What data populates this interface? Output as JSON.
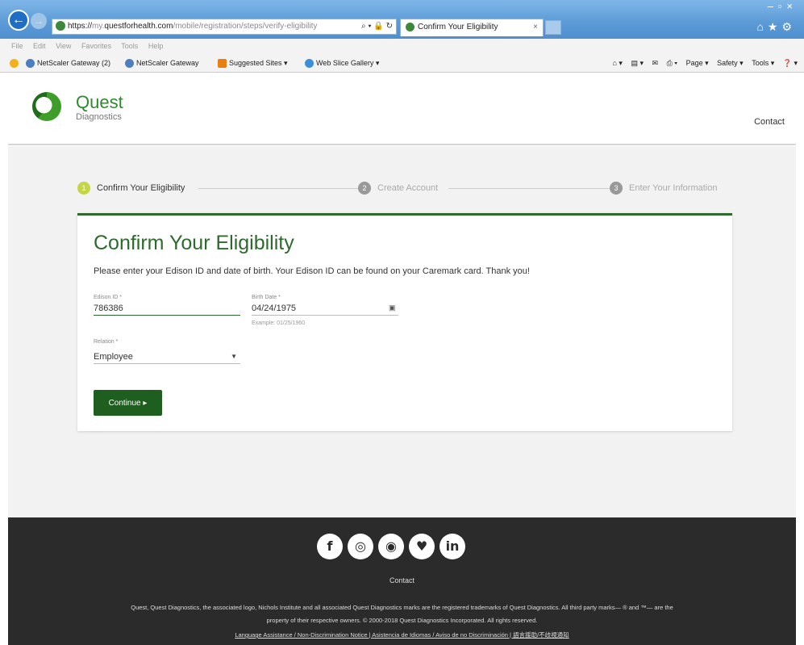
{
  "browser": {
    "url_prefix": "https://",
    "url_domain": "my.questforhealth.com",
    "url_path": "/mobile/registration/steps/verify-eligibility",
    "address_actions": "⌕ ▾ 🔒 ↻",
    "tab_title": "Confirm Your Eligibility",
    "tab_close": "×",
    "menu": [
      "File",
      "Edit",
      "View",
      "Favorites",
      "Tools",
      "Help"
    ],
    "favorites": [
      "NetScaler Gateway (2)",
      "NetScaler Gateway",
      "Suggested Sites ▾",
      "Web Slice Gallery ▾"
    ],
    "commands": [
      "Page ▾",
      "Safety ▾",
      "Tools ▾"
    ]
  },
  "header": {
    "brand_name": "Quest",
    "brand_sub": "Diagnostics",
    "contact": "Contact"
  },
  "stepper": {
    "steps": [
      {
        "number": "1",
        "label": "Confirm Your Eligibility"
      },
      {
        "number": "2",
        "label": "Create Account"
      },
      {
        "number": "3",
        "label": "Enter Your Information"
      }
    ]
  },
  "form": {
    "title": "Confirm Your Eligibility",
    "instructions": "Please enter your Edison ID and date of birth. Your Edison ID can be found on your Caremark card. Thank you!",
    "edison_label": "Edison ID *",
    "edison_value": "786386",
    "birth_label": "Birth Date *",
    "birth_value": "04/24/1975",
    "birth_example": "Example: 01/25/1960",
    "relation_label": "Relation *",
    "relation_value": "Employee",
    "continue_label": "Continue ▸"
  },
  "footer": {
    "social": [
      {
        "icon": "facebook-icon",
        "glyph": "f"
      },
      {
        "icon": "instagram-icon",
        "glyph": "◎"
      },
      {
        "icon": "rss-icon",
        "glyph": "◉"
      },
      {
        "icon": "twitter-icon",
        "glyph": "♥"
      },
      {
        "icon": "linkedin-icon",
        "glyph": "in"
      }
    ],
    "contact": "Contact",
    "legal_1": "Quest, Quest Diagnostics, the associated logo, Nichols Institute and all associated Quest Diagnostics marks are the registered trademarks of Quest Diagnostics. All third party marks— ® and ™— are the",
    "legal_2": "property of their respective owners. © 2000-2018 Quest Diagnostics Incorporated. All rights reserved.",
    "links": "Language Assistance / Non-Discrimination Notice | Asistencia de Idiomas / Aviso de no Discriminación | 語言援助/不歧視通知"
  },
  "colors": {
    "brand_green": "#2d6a2d",
    "button_green": "#1e5e1e",
    "step_active": "#c4d646",
    "footer_bg": "#2b2b2b"
  }
}
